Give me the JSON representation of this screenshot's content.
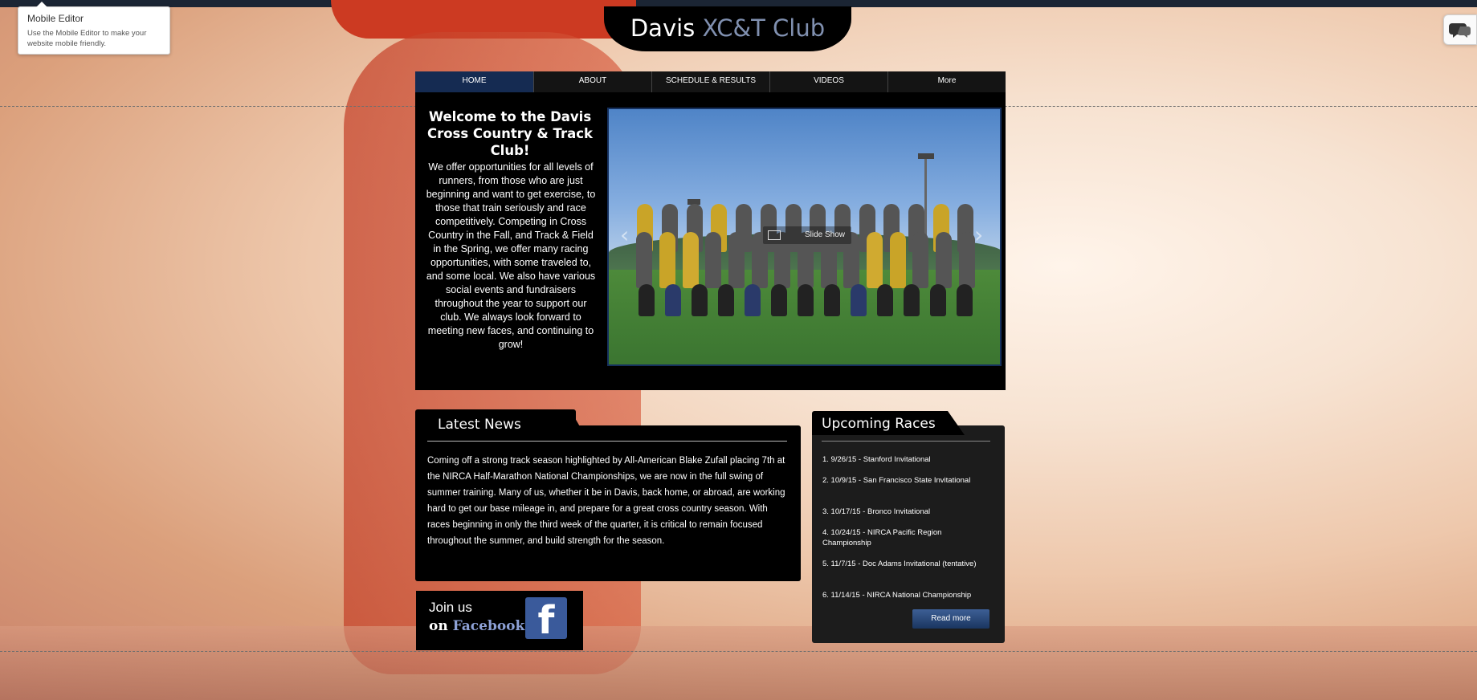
{
  "tooltip": {
    "title": "Mobile Editor",
    "body": "Use the Mobile Editor to make your website mobile friendly."
  },
  "header": {
    "title_main": "Davis",
    "title_accent": "XC&T Club"
  },
  "nav": {
    "items": [
      {
        "label": "HOME",
        "active": true
      },
      {
        "label": "ABOUT",
        "active": false
      },
      {
        "label": "SCHEDULE & RESULTS",
        "active": false
      },
      {
        "label": "VIDEOS",
        "active": false
      },
      {
        "label": "More",
        "active": false
      }
    ]
  },
  "welcome": {
    "title": "Welcome to the Davis Cross Country & Track Club!",
    "text": "We offer opportunities for all levels of runners, from those who are just beginning and want to get exercise, to those that train seriously and race competitively. Competing in Cross Country in the Fall, and Track & Field in the Spring, we offer many racing opportunities, with some traveled to, and some local.  We also have various social events and fundraisers throughout the year to support our club.  We always look forward to meeting new faces, and continuing to grow!"
  },
  "slideshow": {
    "label": "Slide Show",
    "prev_icon": "chevron-left-icon",
    "next_icon": "chevron-right-icon"
  },
  "news": {
    "title": "Latest News",
    "text": "Coming off a strong track season highlighted by All-American Blake Zufall placing 7th at the NIRCA Half-Marathon National Championships, we are now in the full swing of summer training.  Many of us, whether it be in Davis, back home, or abroad, are working hard to get our base mileage in, and prepare for a great cross country season.  With races beginning in only the third week of the quarter, it is critical to remain focused throughout the summer, and build strength for the season."
  },
  "facebook": {
    "line1": "Join us",
    "line2_prefix": "on",
    "line2_brand": "Facebook",
    "logo_letter": "f"
  },
  "races": {
    "title": "Upcoming Races",
    "items": [
      "1. 9/26/15 - Stanford Invitational",
      "2. 10/9/15 - San Francisco State Invitational",
      "3. 10/17/15 - Bronco Invitational",
      "4. 10/24/15 - NIRCA Pacific Region Championship",
      "5. 11/7/15 - Doc Adams Invitational (tentative)",
      "6. 11/14/15 - NIRCA National Championship"
    ],
    "read_more": "Read more"
  },
  "colors": {
    "nav_active": "#152b52",
    "title_accent": "#8090b0",
    "facebook_blue": "#3a5a9b"
  }
}
